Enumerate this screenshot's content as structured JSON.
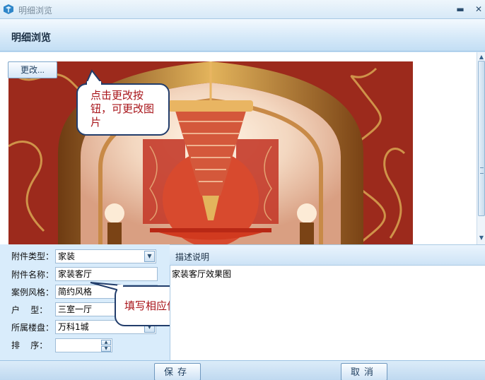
{
  "window": {
    "title": "明细浏览",
    "app_icon": "app-logo-icon",
    "minimize_icon": "minimize-icon",
    "close_icon": "close-icon"
  },
  "header": {
    "title": "明细浏览"
  },
  "image_panel": {
    "change_button": "更改..."
  },
  "callouts": {
    "change_hint": "点击更改按钮，可更改图片",
    "fill_hint": "填写相应信息."
  },
  "form": {
    "attachment_type": {
      "label": "附件类型：",
      "value": "家装"
    },
    "attachment_name": {
      "label": "附件名称：",
      "value": "家装客厅"
    },
    "case_style": {
      "label": "案例风格：",
      "value": "简约风格"
    },
    "unit_type": {
      "label": "户    型：",
      "value": "三室一厅"
    },
    "property": {
      "label": "所属楼盘：",
      "value": "万科1城"
    },
    "sort_order": {
      "label": "排    序：",
      "value": ""
    }
  },
  "description": {
    "header": "描述说明",
    "value": "家装客厅效果图"
  },
  "footer": {
    "save_label": "保存",
    "cancel_label": "取消"
  },
  "colors": {
    "accent": "#c3def4",
    "callout_text": "#a8141a",
    "callout_border": "#223d6b"
  }
}
